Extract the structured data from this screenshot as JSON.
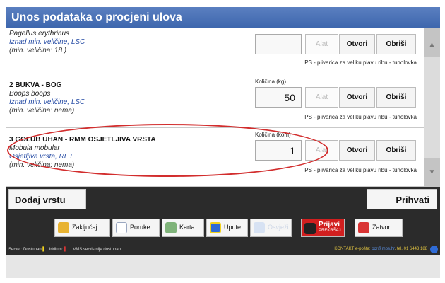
{
  "window": {
    "title": "Unos podataka o procjeni ulova"
  },
  "rows": [
    {
      "name": "",
      "latin": "Pagellus erythrinus",
      "status": "Iznad min. veličine, LSC",
      "minsize": "(min. veličina: 18 )",
      "qty_label": "",
      "qty_value": "",
      "gear_label": "Alat",
      "open_label": "Otvori",
      "delete_label": "Obriši",
      "gear_text": "PS - plivarica za veliku plavu ribu - tunolovka"
    },
    {
      "name": "2 BUKVA - BOG",
      "latin": "Boops boops",
      "status": "Iznad min. veličine, LSC",
      "minsize": "(min. veličina: nema)",
      "qty_label": "Količina (kg)",
      "qty_value": "50",
      "gear_label": "Alat",
      "open_label": "Otvori",
      "delete_label": "Obriši",
      "gear_text": "PS - plivarica za veliku plavu ribu - tunolovka"
    },
    {
      "name": "3 GOLUB UHAN - RMM OSJETLJIVA VRSTA",
      "latin": "Mobula mobular",
      "status": "Osjetljiva vrsta, RET",
      "minsize": "(min. veličina: nema)",
      "qty_label": "Količina (kom)",
      "qty_value": "1",
      "gear_label": "Alat",
      "open_label": "Otvori",
      "delete_label": "Obriši",
      "gear_text": "PS - plivarica za veliku plavu ribu - tunolovka"
    }
  ],
  "actions": {
    "add_species": "Dodaj vrstu",
    "accept": "Prihvati"
  },
  "toolbar": {
    "lock": "Zaključaj",
    "messages": "Poruke",
    "map": "Karta",
    "instructions": "Upute",
    "disabled": "Osvježi",
    "report": "Prijavi",
    "report_sub": "PREKRŠAJ",
    "close": "Zatvori"
  },
  "statusbar": {
    "server": "Server: Dostupan",
    "iridium": "Iridium:",
    "vms": "VMS servis nije dostupan",
    "contact": "KONTAKT e-pošta:",
    "contact_email": "ocr@mps.hr",
    "contact_phone": ", tel. 01 6443 188"
  },
  "colors": {
    "title_bg": "#3d66ad",
    "dark_bg": "#2b2b2b",
    "highlight": "#d22d2d",
    "link": "#2a4fa6"
  }
}
